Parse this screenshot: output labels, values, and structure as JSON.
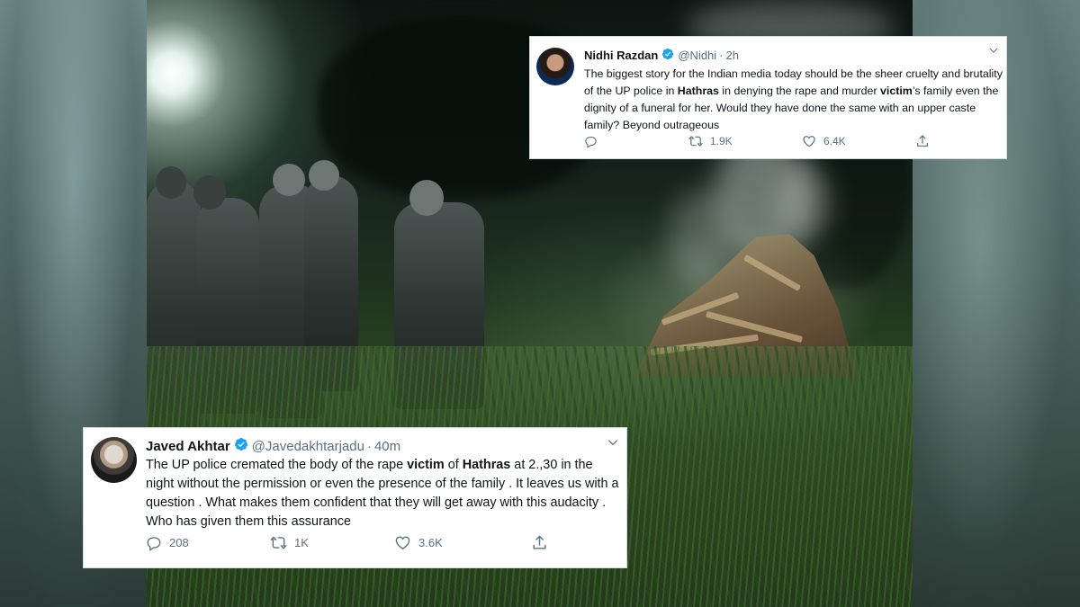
{
  "tweets": {
    "top": {
      "name": "Nidhi Razdan",
      "handle": "@Nidhi",
      "separator": "·",
      "time": "2h",
      "text": {
        "p1": "The biggest story for the Indian media today should be the sheer cruelty and brutality of the UP police in ",
        "b1": "Hathras",
        "p2": " in denying the rape and murder ",
        "b2": "victim",
        "p3": "’s family even the dignity of a funeral for her. Would they have done the same with an upper caste family? Beyond outrageous"
      },
      "replies": "",
      "retweets": "1.9K",
      "likes": "6.4K"
    },
    "bottom": {
      "name": "Javed Akhtar",
      "handle": "@Javedakhtarjadu",
      "separator": "·",
      "time": "40m",
      "text": {
        "p1": "The UP police cremated the body of the rape  ",
        "b1": "victim",
        "p2": " of ",
        "b2": "Hathras",
        "p3": " at 2.,30 in the night without the permission or even the presence of the family . It leaves us with a question . What makes them confident that they will get away with this audacity . Who has given them this assurance"
      },
      "replies": "208",
      "retweets": "1K",
      "likes": "3.6K"
    }
  },
  "colors": {
    "verified": "#1da1f2",
    "muted": "#5b7083",
    "text": "#0f1419",
    "card": "#ffffff"
  },
  "icons": [
    "verified-badge-icon",
    "chevron-down-icon",
    "reply-icon",
    "retweet-icon",
    "like-icon",
    "share-icon"
  ]
}
